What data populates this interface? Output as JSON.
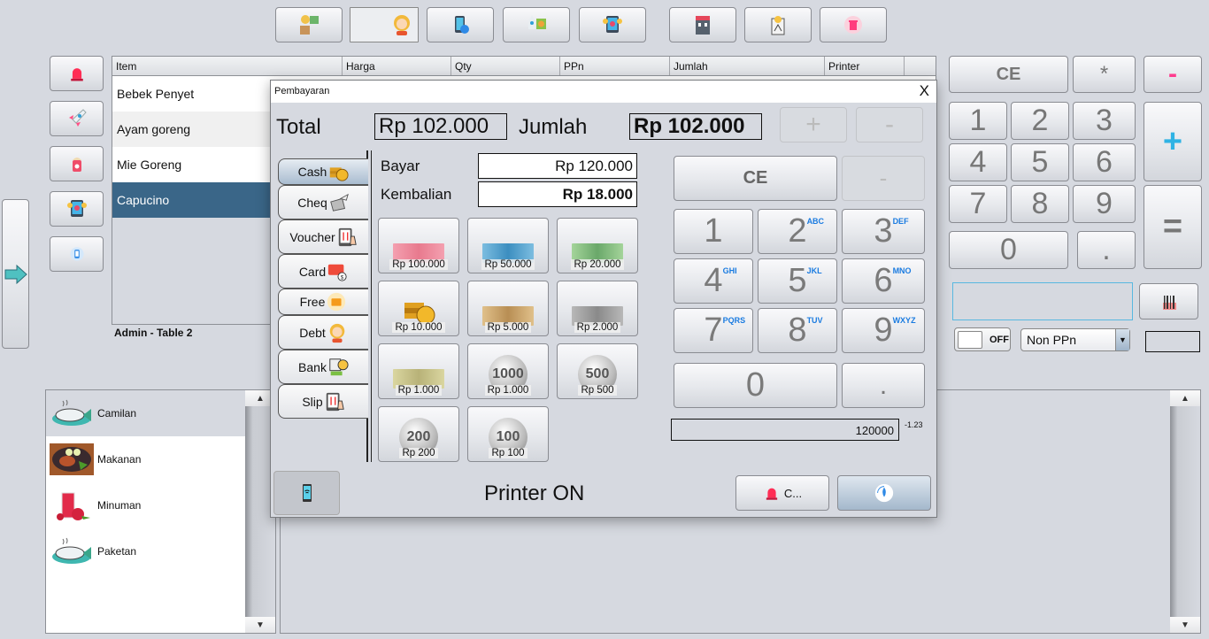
{
  "toolbar": {
    "buttons": [
      {
        "name": "design-tools-button",
        "icon": "design-tools-icon"
      },
      {
        "name": "user-profile-button",
        "icon": "woman-avatar-icon"
      },
      {
        "name": "mobile-sync-button",
        "icon": "mobile-sync-icon"
      },
      {
        "name": "launch-settings-button",
        "icon": "rocket-gear-icon"
      },
      {
        "name": "tablet-menu-button",
        "icon": "tablet-hands-icon"
      },
      {
        "name": "store-button",
        "icon": "store-icon"
      },
      {
        "name": "idea-network-button",
        "icon": "idea-network-icon"
      },
      {
        "name": "delete-button",
        "icon": "trash-icon"
      }
    ]
  },
  "side_buttons": [
    {
      "name": "alarm-button",
      "icon": "siren-icon"
    },
    {
      "name": "rocket-button",
      "icon": "rocket-icon"
    },
    {
      "name": "drink-button",
      "icon": "drink-cup-icon"
    },
    {
      "name": "tablet-button",
      "icon": "tablet-hands-icon"
    },
    {
      "name": "phone-button",
      "icon": "phone-icon"
    }
  ],
  "order_table": {
    "columns": [
      "Item",
      "Harga",
      "Qty",
      "PPn",
      "Jumlah",
      "Printer"
    ],
    "rows": [
      {
        "item": "Bebek Penyet"
      },
      {
        "item": "Ayam goreng"
      },
      {
        "item": "Mie Goreng"
      },
      {
        "item": "Capucino",
        "selected": true
      }
    ]
  },
  "admin_label": "Admin - Table 2",
  "categories": [
    {
      "label": "Camilan",
      "icon": "fish-dish-icon",
      "selected": true
    },
    {
      "label": "Makanan",
      "icon": "chicken-plate-icon"
    },
    {
      "label": "Minuman",
      "icon": "juice-glass-icon"
    },
    {
      "label": "Paketan",
      "icon": "fish-dish-icon"
    }
  ],
  "calculator": {
    "ce": "CE",
    "multiply": "*",
    "minus": "-",
    "plus": "+",
    "equals": "=",
    "digits": [
      "1",
      "2",
      "3",
      "4",
      "5",
      "6",
      "7",
      "8",
      "9"
    ],
    "zero": "0",
    "dot": ".",
    "accent_minus": "#ff3c8e",
    "accent_plus": "#2fb3e4"
  },
  "right_panel": {
    "input_value": "",
    "toggle_label": "OFF",
    "ppn_selected": "Non PPn"
  },
  "dialog": {
    "title": "Pembayaran",
    "close": "X",
    "total_label": "Total",
    "total_value": "Rp 102.000",
    "jumlah_label": "Jumlah",
    "jumlah_value": "Rp 102.000",
    "plus": "+",
    "minus": "-",
    "bayar_label": "Bayar",
    "bayar_value": "Rp 120.000",
    "kembalian_label": "Kembalian",
    "kembalian_value": "Rp 18.000",
    "tabs": [
      {
        "label": "Cash",
        "icon": "coins-icon",
        "active": true
      },
      {
        "label": "Cheq",
        "icon": "envelope-wing-icon"
      },
      {
        "label": "Voucher",
        "icon": "restaurant-tablet-icon"
      },
      {
        "label": "Card",
        "icon": "credit-card-icon"
      },
      {
        "label": "Free",
        "icon": "wallet-icon"
      },
      {
        "label": "Debt",
        "icon": "woman-avatar-icon"
      },
      {
        "label": "Bank",
        "icon": "bank-transfer-icon"
      },
      {
        "label": "Slip",
        "icon": "restaurant-tablet-icon"
      }
    ],
    "money": [
      {
        "label": "Rp 100.000",
        "kind": "note",
        "color": "#e88a9a"
      },
      {
        "label": "Rp 50.000",
        "kind": "note",
        "color": "#5aa0c8"
      },
      {
        "label": "Rp 20.000",
        "kind": "note",
        "color": "#7cb87a"
      },
      {
        "label": "Rp 10.000",
        "kind": "coins",
        "color": "#d39a2a"
      },
      {
        "label": "Rp 5.000",
        "kind": "note",
        "color": "#c9a36a"
      },
      {
        "label": "Rp 2.000",
        "kind": "note",
        "color": "#9a9a9a"
      },
      {
        "label": "Rp 1.000",
        "kind": "note",
        "color": "#c8c48a"
      },
      {
        "label": "Rp 1.000",
        "kind": "coin",
        "face": "1000"
      },
      {
        "label": "Rp 500",
        "kind": "coin",
        "face": "500"
      },
      {
        "label": "Rp 200",
        "kind": "coin",
        "face": "200"
      },
      {
        "label": "Rp 100",
        "kind": "coin",
        "face": "100"
      }
    ],
    "keypad": {
      "ce": "CE",
      "minus": "-",
      "keys": [
        {
          "d": "1",
          "l": ""
        },
        {
          "d": "2",
          "l": "ABC"
        },
        {
          "d": "3",
          "l": "DEF"
        },
        {
          "d": "4",
          "l": "GHI"
        },
        {
          "d": "5",
          "l": "JKL"
        },
        {
          "d": "6",
          "l": "MNO"
        },
        {
          "d": "7",
          "l": "PQRS"
        },
        {
          "d": "8",
          "l": "TUV"
        },
        {
          "d": "9",
          "l": "WXYZ"
        }
      ],
      "zero": "0",
      "dot": "."
    },
    "display_value": "120000",
    "display_sup": "-1.23",
    "printer_status": "Printer ON",
    "cancel_label": "C...",
    "mobile_icon": "mobile-wifi-icon"
  }
}
